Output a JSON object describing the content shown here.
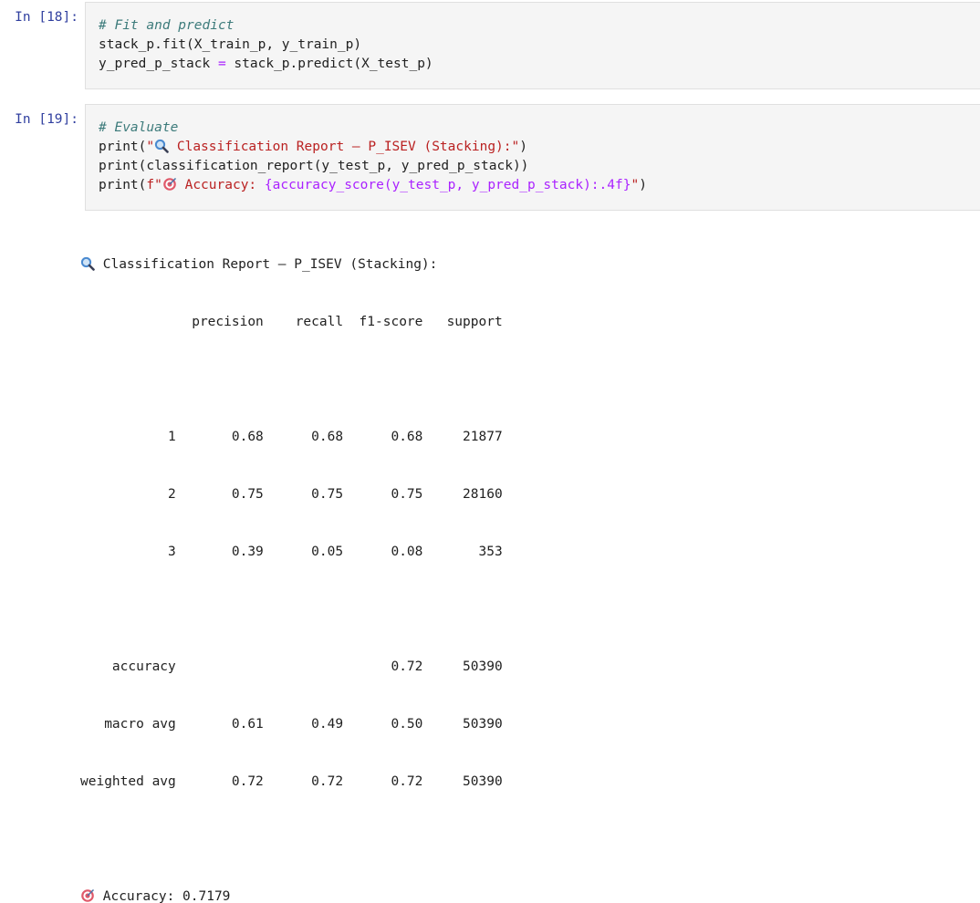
{
  "cell18": {
    "prompt": "In [18]:",
    "lines": [
      {
        "comment": "# Fit and predict"
      },
      {
        "text": "stack_p.fit(X_train_p, y_train_p)"
      },
      {
        "lhs": "y_pred_p_stack ",
        "op": "=",
        "rhs": " stack_p.predict(X_test_p)"
      }
    ]
  },
  "cell19": {
    "prompt": "In [19]:",
    "comment": "# Evaluate",
    "line2": {
      "pre": "print(",
      "quote": "\"",
      "icon": "magnifier-icon",
      "str": " Classification Report – P_ISEV (Stacking):\"",
      "post": ")"
    },
    "line3": "print(classification_report(y_test_p, y_pred_p_stack))",
    "line4": {
      "pre": "print(",
      "prefix": "f\"",
      "icon": "target-icon",
      "str_a": " Accuracy: ",
      "expr": "{accuracy_score(y_test_p, y_pred_p_stack):.4f}",
      "str_b": "\"",
      "post": ")"
    }
  },
  "output": {
    "title": " Classification Report – P_ISEV (Stacking):",
    "title_icon": "magnifier-icon",
    "report_lines": [
      "              precision    recall  f1-score   support",
      "",
      "           1       0.68      0.68      0.68     21877",
      "           2       0.75      0.75      0.75     28160",
      "           3       0.39      0.05      0.08       353",
      "",
      "    accuracy                           0.72     50390",
      "   macro avg       0.61      0.49      0.50     50390",
      "weighted avg       0.72      0.72      0.72     50390"
    ],
    "accuracy_line": " Accuracy: 0.7179",
    "accuracy_icon": "target-icon"
  },
  "colors": {
    "prompt": "#303f9f",
    "comment": "#3d7b7b",
    "string": "#ba2121",
    "operator": "#aa22ff",
    "cell_bg": "#f5f5f5"
  }
}
